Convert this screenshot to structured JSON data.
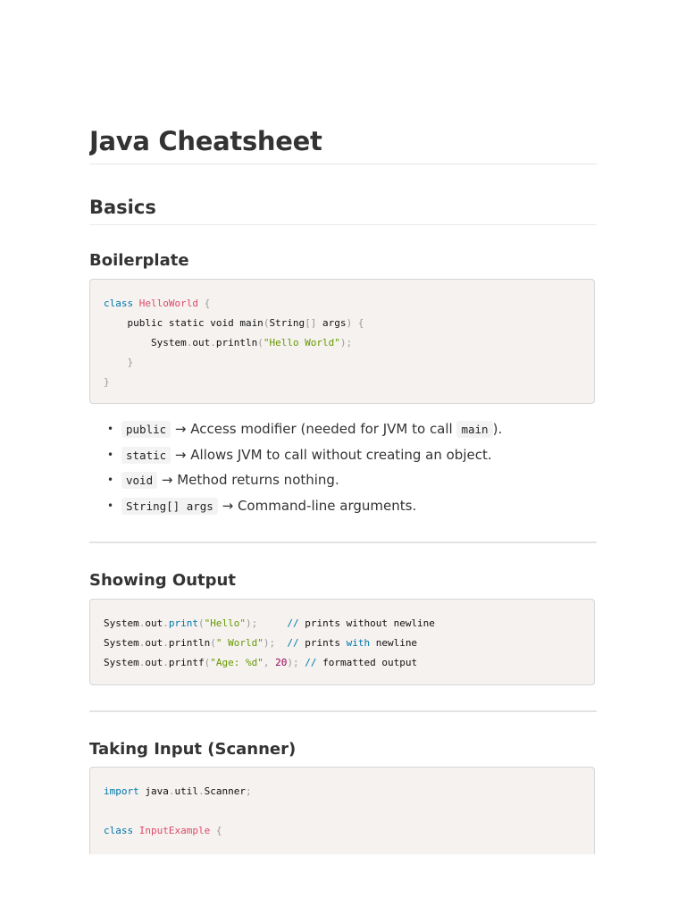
{
  "title": "Java Cheatsheet",
  "section": "Basics",
  "boilerplate": {
    "heading": "Boilerplate",
    "code": [
      [
        [
          "class",
          "keyword"
        ],
        [
          " ",
          "plain"
        ],
        [
          "HelloWorld",
          "class"
        ],
        [
          " {",
          "punct"
        ]
      ],
      [
        [
          "    public static void main",
          "plain"
        ],
        [
          "(",
          "punct"
        ],
        [
          "String",
          "plain"
        ],
        [
          "[]",
          "punct"
        ],
        [
          " args",
          "plain"
        ],
        [
          ")",
          "punct"
        ],
        [
          " {",
          "punct"
        ]
      ],
      [
        [
          "        System",
          "plain"
        ],
        [
          ".",
          "punct"
        ],
        [
          "out",
          "plain"
        ],
        [
          ".",
          "punct"
        ],
        [
          "println",
          "plain"
        ],
        [
          "(",
          "punct"
        ],
        [
          "\"Hello World\"",
          "string"
        ],
        [
          ");",
          "punct"
        ]
      ],
      [
        [
          "    }",
          "punct"
        ]
      ],
      [
        [
          "}",
          "punct"
        ]
      ]
    ],
    "bullets": [
      {
        "code": "public",
        "text": " → Access modifier (needed for JVM to call ",
        "code2": "main",
        "text2": ")."
      },
      {
        "code": "static",
        "text": " → Allows JVM to call without creating an object.",
        "code2": "",
        "text2": ""
      },
      {
        "code": "void",
        "text": " → Method returns nothing.",
        "code2": "",
        "text2": ""
      },
      {
        "code": "String[] args",
        "text": " → Command-line arguments.",
        "code2": "",
        "text2": ""
      }
    ]
  },
  "output": {
    "heading": "Showing Output",
    "code": [
      [
        [
          "System",
          "plain"
        ],
        [
          ".",
          "punct"
        ],
        [
          "out",
          "plain"
        ],
        [
          ".",
          "punct"
        ],
        [
          "print",
          "keyword"
        ],
        [
          "(",
          "punct"
        ],
        [
          "\"Hello\"",
          "string"
        ],
        [
          ");",
          "punct"
        ],
        [
          "     ",
          "plain"
        ],
        [
          "//",
          "keyword"
        ],
        [
          " prints without newline",
          "plain"
        ]
      ],
      [
        [
          "System",
          "plain"
        ],
        [
          ".",
          "punct"
        ],
        [
          "out",
          "plain"
        ],
        [
          ".",
          "punct"
        ],
        [
          "println",
          "plain"
        ],
        [
          "(",
          "punct"
        ],
        [
          "\" World\"",
          "string"
        ],
        [
          ");",
          "punct"
        ],
        [
          "  ",
          "plain"
        ],
        [
          "//",
          "keyword"
        ],
        [
          " prints ",
          "plain"
        ],
        [
          "with",
          "keyword"
        ],
        [
          " newline",
          "plain"
        ]
      ],
      [
        [
          "System",
          "plain"
        ],
        [
          ".",
          "punct"
        ],
        [
          "out",
          "plain"
        ],
        [
          ".",
          "punct"
        ],
        [
          "printf",
          "plain"
        ],
        [
          "(",
          "punct"
        ],
        [
          "\"Age: %d\"",
          "string"
        ],
        [
          ", ",
          "punct"
        ],
        [
          "20",
          "number"
        ],
        [
          ");",
          "punct"
        ],
        [
          " ",
          "plain"
        ],
        [
          "//",
          "keyword"
        ],
        [
          " formatted output",
          "plain"
        ]
      ]
    ]
  },
  "input": {
    "heading": "Taking Input (Scanner)",
    "code": [
      [
        [
          "import",
          "keyword"
        ],
        [
          " java",
          "plain"
        ],
        [
          ".",
          "punct"
        ],
        [
          "util",
          "plain"
        ],
        [
          ".",
          "punct"
        ],
        [
          "Scanner",
          "plain"
        ],
        [
          ";",
          "punct"
        ]
      ],
      [],
      [
        [
          "class",
          "keyword"
        ],
        [
          " ",
          "plain"
        ],
        [
          "InputExample",
          "class"
        ],
        [
          " {",
          "punct"
        ]
      ]
    ]
  }
}
